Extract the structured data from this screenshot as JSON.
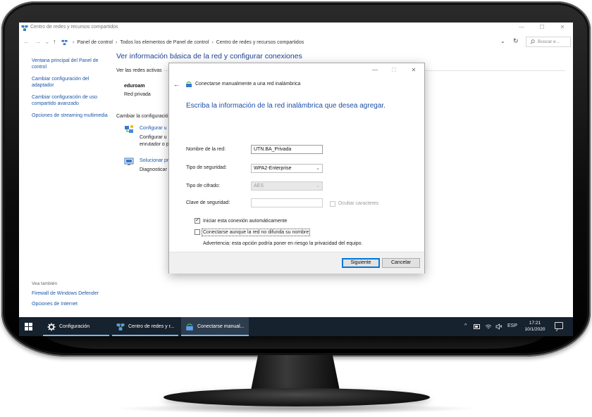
{
  "window": {
    "title": "Centro de redes y recursos compartidos",
    "controls": {
      "minimize": "—",
      "maximize": "☐",
      "close": "✕"
    }
  },
  "address_bar": {
    "back": "←",
    "forward": "→",
    "up": "↑",
    "breadcrumbs": [
      "Panel de control",
      "Todos los elementos de Panel de control",
      "Centro de redes y recursos compartidos"
    ],
    "separator": "›",
    "dropdown": "⌄",
    "refresh": "↻",
    "search_placeholder": "Buscar e..."
  },
  "left_pane": {
    "links": [
      "Ventana principal del Panel de control",
      "Cambiar configuración del adaptador",
      "Cambiar configuración de uso compartido avanzado",
      "Opciones de streaming multimedia"
    ],
    "see_also_title": "Vea también",
    "see_also_links": [
      "Firewall de Windows Defender",
      "Opciones de Internet"
    ]
  },
  "main": {
    "title": "Ver información básica de la red y configurar conexiones",
    "active_networks_heading": "Ver las redes activas",
    "network_name": "eduroam",
    "network_type": "Red privada",
    "change_settings_heading": "Cambiar la configuració",
    "options": [
      {
        "link": "Configurar u",
        "desc_lines": [
          "Configurar u",
          "enrutador o p"
        ],
        "icon": "network-setup-icon"
      },
      {
        "link": "Solucionar pr",
        "desc_lines": [
          "Diagnosticar"
        ],
        "icon": "troubleshoot-icon"
      }
    ]
  },
  "dialog": {
    "controls": {
      "minimize": "—",
      "maximize": "☐",
      "close": "✕"
    },
    "back": "←",
    "caption": "Conectarse manualmente a una red inalámbrica",
    "heading": "Escriba la información de la red inalámbrica que desea agregar.",
    "fields": {
      "network_name_label": "Nombre de la red:",
      "network_name_value": "UTN.BA_Privada",
      "security_type_label": "Tipo de seguridad:",
      "security_type_value": "WPA2-Enterprise",
      "encryption_label": "Tipo de cifrado:",
      "encryption_value": "AES",
      "security_key_label": "Clave de seguridad:",
      "security_key_value": "",
      "hide_chars_label": "Ocultar caracteres"
    },
    "auto_connect_label": "Iniciar esta conexión automáticamente",
    "auto_connect_checked": true,
    "connect_hidden_label": "Conectarse aunque la red no difunda su nombre",
    "connect_hidden_checked": false,
    "warning": "Advertencia: esta opción podría poner en riesgo la privacidad del equipo.",
    "next_button": "Siguiente",
    "cancel_button": "Cancelar"
  },
  "taskbar": {
    "tasks": [
      {
        "label": "Configuración",
        "icon": "gear-icon"
      },
      {
        "label": "Centro de redes y r...",
        "icon": "network-center-icon"
      },
      {
        "label": "Conectarse manual...",
        "icon": "wireless-setup-icon"
      }
    ],
    "tray": {
      "chevron": "^",
      "language": "ESP",
      "time": "17:21",
      "date": "10/1/2020"
    }
  },
  "colors": {
    "link_blue": "#1a56a8",
    "heading_blue": "#1e3f94",
    "taskbar_bg": "#16222e",
    "accent": "#0078d7"
  }
}
